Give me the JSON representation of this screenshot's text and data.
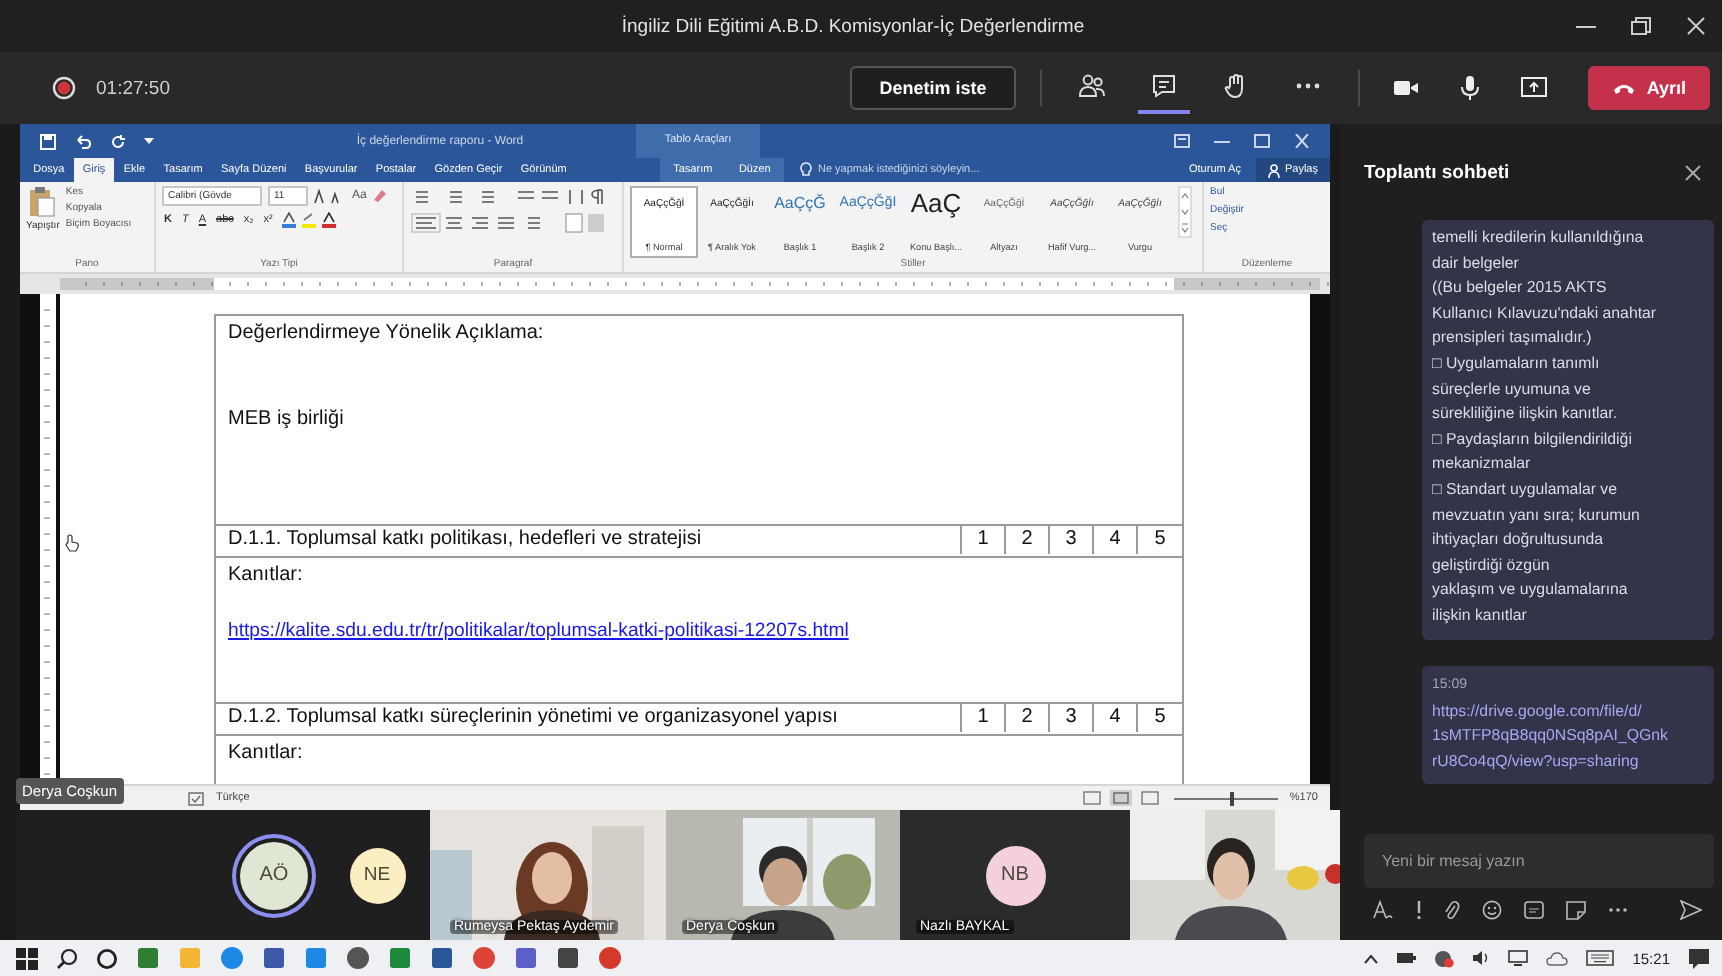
{
  "window": {
    "title": "İngiliz Dili Eğitimi A.B.D. Komisyonlar-İç Değerlendirme"
  },
  "meeting_bar": {
    "recording": true,
    "timer": "01:27:50",
    "control_button": "Denetim iste",
    "tools": [
      {
        "kind": "people",
        "selected": false
      },
      {
        "kind": "chat",
        "selected": true
      },
      {
        "kind": "hand",
        "selected": false
      },
      {
        "kind": "more",
        "selected": false
      }
    ],
    "leave_button": "Ayrıl"
  },
  "word": {
    "title": "İç değerlendirme raporu - Word",
    "context_group": {
      "label": "Tablo Araçları",
      "tabs": [
        "Tasarım",
        "Düzen"
      ]
    },
    "tabs": [
      {
        "label": "Dosya",
        "selected": false
      },
      {
        "label": "Giriş",
        "selected": true
      },
      {
        "label": "Ekle",
        "selected": false
      },
      {
        "label": "Tasarım",
        "selected": false
      },
      {
        "label": "Sayfa Düzeni",
        "selected": false
      },
      {
        "label": "Başvurular",
        "selected": false
      },
      {
        "label": "Postalar",
        "selected": false
      },
      {
        "label": "Gözden Geçir",
        "selected": false
      },
      {
        "label": "Görünüm",
        "selected": false
      }
    ],
    "tell_me": "Ne yapmak istediğinizi söyleyin...",
    "sign_in": "Oturum Aç",
    "share": "Paylaş",
    "ribbon": {
      "clipboard": {
        "paste": "Yapıştır",
        "items": [
          "Kes",
          "Kopyala",
          "Biçim Boyacısı"
        ],
        "label": "Pano"
      },
      "font": {
        "family": "Calibri (Gövde",
        "size": "11",
        "case": "Aa",
        "buttons": [
          "K",
          "T",
          "A",
          "abc",
          "x₂",
          "x²"
        ],
        "label": "Yazı Tipi"
      },
      "paragraph": {
        "label": "Paragraf"
      },
      "styles": {
        "label": "Stiller",
        "items": [
          {
            "preview": "AaÇçĞğİ",
            "name": "¶ Normal",
            "kind": "normal",
            "selected": true
          },
          {
            "preview": "AaÇçĞğİı",
            "name": "¶ Aralık Yok",
            "kind": "normal",
            "selected": false
          },
          {
            "preview": "AaÇçĞ",
            "name": "Başlık 1",
            "kind": "heading1",
            "selected": false
          },
          {
            "preview": "AaÇçĞğI",
            "name": "Başlık 2",
            "kind": "heading2",
            "selected": false
          },
          {
            "preview": "AaÇ",
            "name": "Konu Başlı...",
            "kind": "title",
            "selected": false
          },
          {
            "preview": "AaÇçĞğİ",
            "name": "Altyazı",
            "kind": "subtitle",
            "selected": false
          },
          {
            "preview": "AaÇçĞğİı",
            "name": "Hafif Vurg...",
            "kind": "emphasis",
            "selected": false
          },
          {
            "preview": "AaÇçĞğİı",
            "name": "Vurgu",
            "kind": "emphasis",
            "selected": false
          }
        ]
      },
      "editing": {
        "label": "Düzenleme",
        "items": [
          "Bul",
          "Değiştir",
          "Seç"
        ]
      }
    },
    "document": {
      "rows": [
        {
          "kind": "text",
          "lines": [
            "Değerlendirmeye Yönelik Açıklama:",
            "MEB iş birliği"
          ]
        },
        {
          "kind": "criterion",
          "text": "D.1.1. Toplumsal katkı politikası, hedefleri ve stratejisi",
          "scores": [
            "1",
            "2",
            "3",
            "4",
            "5"
          ]
        },
        {
          "kind": "evidence",
          "label": "Kanıtlar:",
          "link": "https://kalite.sdu.edu.tr/tr/politikalar/toplumsal-katki-politikasi-12207s.html"
        },
        {
          "kind": "criterion",
          "text": "D.1.2. Toplumsal katkı süreçlerinin yönetimi ve organizasyonel yapısı",
          "scores": [
            "1",
            "2",
            "3",
            "4",
            "5"
          ]
        },
        {
          "kind": "evidence",
          "label": "Kanıtlar:"
        }
      ]
    },
    "status_bar": {
      "language": "Türkçe",
      "zoom": "%170",
      "zoom_slider": {
        "level": 0.55
      }
    },
    "tooltip": "Derya Coşkun"
  },
  "participants": [
    {
      "kind": "avatar",
      "initials": "AÖ",
      "color": "#dfe6d3",
      "speaking": true
    },
    {
      "kind": "avatar",
      "initials": "NE",
      "color": "#fbeec0",
      "speaking": false
    },
    {
      "kind": "video",
      "name": "Rumeysa Pektaş Aydemir"
    },
    {
      "kind": "video",
      "name": "Derya Coşkun"
    },
    {
      "kind": "avatar",
      "initials": "NB",
      "color": "#f4d0de",
      "speaking": false,
      "name": "Nazlı BAYKAL"
    },
    {
      "kind": "video"
    }
  ],
  "chat": {
    "title": "Toplantı sohbeti",
    "messages": [
      {
        "lines": [
          "temelli kredilerin kullanıldığına",
          "dair belgeler",
          "((Bu belgeler 2015 AKTS",
          "Kullanıcı Kılavuzu'ndaki anahtar",
          "prensipleri taşımalıdır.)",
          "□ Uygulamaların tanımlı",
          "süreçlerle uyumuna ve",
          "sürekliliğine ilişkin kanıtlar.",
          "□ Paydaşların bilgilendirildiği",
          "mekanizmalar",
          "□ Standart uygulamalar ve",
          "mevzuatın yanı sıra; kurumun",
          "ihtiyaçları doğrultusunda",
          "geliştirdiği özgün",
          "yaklaşım ve uygulamalarına",
          "ilişkin kanıtlar"
        ]
      },
      {
        "time": "15:09",
        "link_lines": [
          "https://drive.google.com/file/d/",
          "1sMTFP8qB8qq0NSq8pAI_QGnk",
          "rU8Co4qQ/view?usp=sharing"
        ]
      }
    ],
    "compose": {
      "placeholder": "Yeni bir mesaj yazın"
    }
  },
  "taskbar": {
    "clock": "15:21"
  }
}
